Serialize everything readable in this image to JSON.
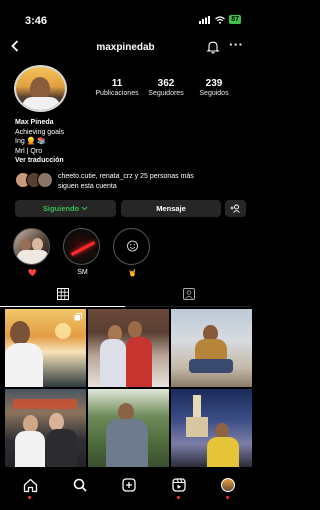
{
  "status_bar": {
    "time": "3:46",
    "battery": "87"
  },
  "header": {
    "username": "maxpinedab"
  },
  "stats": [
    {
      "value": "11",
      "label": "Publicaciones"
    },
    {
      "value": "362",
      "label": "Seguidores"
    },
    {
      "value": "239",
      "label": "Seguidos"
    }
  ],
  "bio": {
    "name": "Max Pineda",
    "line1": "Achieving goals",
    "line2": "Ing 👱 📚",
    "line3": "Mrl | Qro",
    "translate": "Ver traducción"
  },
  "followed_by": {
    "line1": "cheeto.cutie, renata_crz y 25 personas más",
    "line2": "siguen esta cuenta"
  },
  "buttons": {
    "following": "Siguiendo",
    "message": "Mensaje"
  },
  "highlights": [
    {
      "label": "❤️"
    },
    {
      "label": "SM"
    },
    {
      "label": "🤘"
    }
  ]
}
